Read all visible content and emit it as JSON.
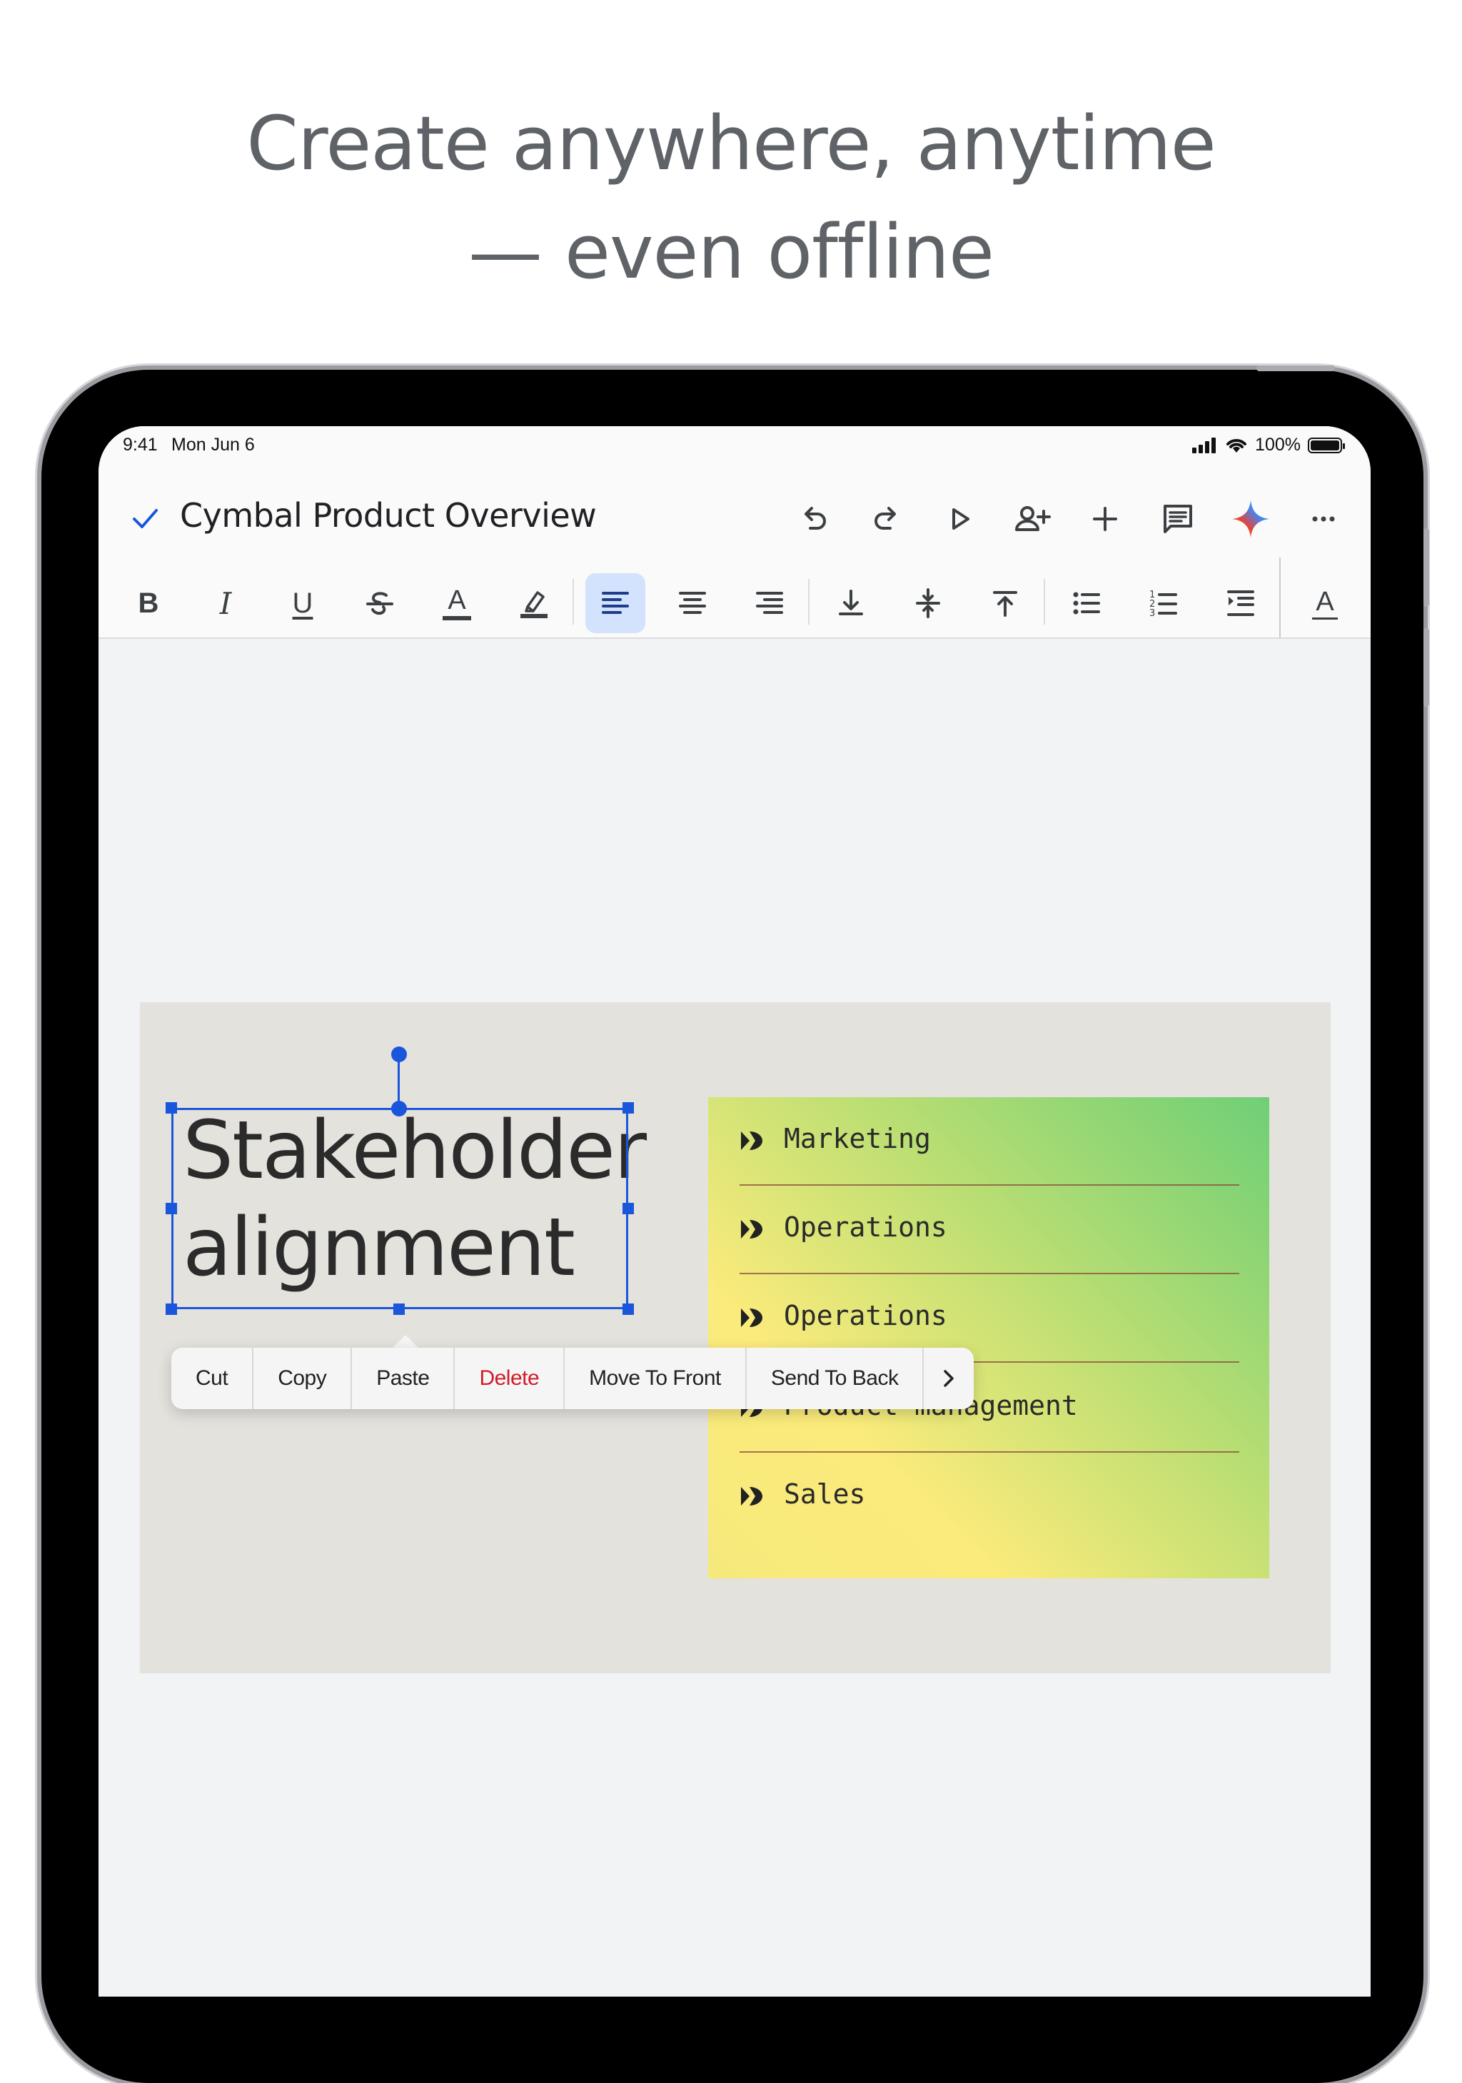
{
  "headline": {
    "line1": "Create anywhere, anytime",
    "line2": "— even offline"
  },
  "status_bar": {
    "time": "9:41",
    "date": "Mon Jun 6",
    "battery": "100%"
  },
  "titlebar": {
    "doc_title": "Cymbal Product Overview",
    "icons": [
      "check-icon",
      "undo-icon",
      "redo-icon",
      "present-play-icon",
      "add-person-icon",
      "insert-plus-icon",
      "comments-icon",
      "gemini-sparkle-icon",
      "more-horizontal-icon"
    ]
  },
  "format_toolbar": {
    "active": "align-left",
    "icons": [
      "bold-icon",
      "italic-icon",
      "underline-icon",
      "strikethrough-icon",
      "text-color-icon",
      "highlight-icon",
      "align-left-icon",
      "align-center-icon",
      "align-right-icon",
      "vertical-align-bottom-icon",
      "vertical-align-middle-icon",
      "vertical-align-top-icon",
      "bulleted-list-icon",
      "numbered-list-icon",
      "indent-icon",
      "text-format-icon"
    ],
    "labels": {
      "bold": "B",
      "italic": "I",
      "underline": "U",
      "text_color": "A",
      "text_format": "A"
    }
  },
  "slide": {
    "title_line1": "Stakeholder",
    "title_line2": "alignment",
    "list": [
      "Marketing",
      "Operations",
      "Operations",
      "Product management",
      "Sales"
    ],
    "colors": {
      "background": "#e4e2dc",
      "gradient_start": "#6fcf76",
      "gradient_end": "#fbeb7b",
      "selection": "#1a56db"
    }
  },
  "context_menu": {
    "items": [
      "Cut",
      "Copy",
      "Paste",
      "Delete",
      "Move To Front",
      "Send To Back"
    ],
    "danger_item": "Delete",
    "more_icon": "chevron-right-icon"
  }
}
